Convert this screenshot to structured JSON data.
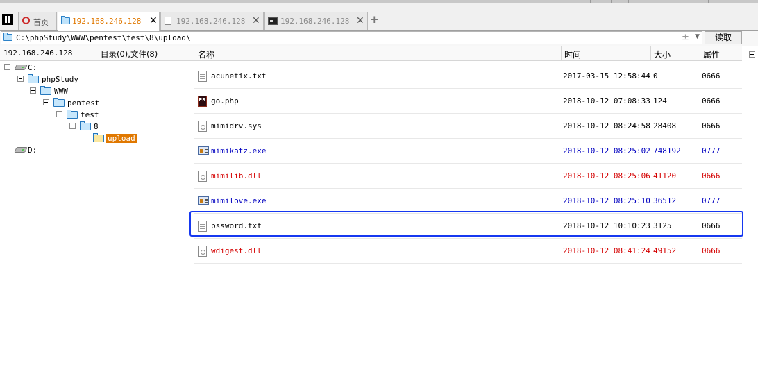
{
  "tabs": [
    {
      "label": "首页",
      "icon": "home-icon"
    },
    {
      "label": "192.168.246.128",
      "icon": "folder-icon",
      "active": true
    },
    {
      "label": "192.168.246.128",
      "icon": "file-icon"
    },
    {
      "label": "192.168.246.128",
      "icon": "terminal-icon"
    }
  ],
  "address": {
    "path": "C:\\phpStudy\\WWW\\pentest\\test\\8\\upload\\",
    "plusminus": "±",
    "read_label": "读取"
  },
  "left": {
    "host": "192.168.246.128",
    "summary": "目录(0),文件(8)"
  },
  "tree": [
    {
      "label": "C:",
      "type": "drive"
    },
    {
      "label": "phpStudy",
      "type": "folder"
    },
    {
      "label": "WWW",
      "type": "folder"
    },
    {
      "label": "pentest",
      "type": "folder"
    },
    {
      "label": "test",
      "type": "folder"
    },
    {
      "label": "8",
      "type": "folder"
    },
    {
      "label": "upload",
      "type": "folder",
      "selected": true
    },
    {
      "label": "D:",
      "type": "drive"
    }
  ],
  "columns": {
    "name": "名称",
    "time": "时间",
    "size": "大小",
    "attr": "属性"
  },
  "files": [
    {
      "name": "acunetix.txt",
      "time": "2017-03-15 12:58:44",
      "size": "0",
      "attr": "0666",
      "icon": "text-file-icon",
      "color": "#000000"
    },
    {
      "name": "go.php",
      "time": "2018-10-12 07:08:33",
      "size": "124",
      "attr": "0666",
      "icon": "php-file-icon",
      "color": "#000000"
    },
    {
      "name": "mimidrv.sys",
      "time": "2018-10-12 08:24:58",
      "size": "28408",
      "attr": "0666",
      "icon": "system-file-icon",
      "color": "#000000"
    },
    {
      "name": "mimikatz.exe",
      "time": "2018-10-12 08:25:02",
      "size": "748192",
      "attr": "0777",
      "icon": "exe-file-icon",
      "color": "#0000c0"
    },
    {
      "name": "mimilib.dll",
      "time": "2018-10-12 08:25:06",
      "size": "41120",
      "attr": "0666",
      "icon": "dll-file-icon",
      "color": "#d40000"
    },
    {
      "name": "mimilove.exe",
      "time": "2018-10-12 08:25:10",
      "size": "36512",
      "attr": "0777",
      "icon": "exe-file-icon",
      "color": "#0000c0"
    },
    {
      "name": "pssword.txt",
      "time": "2018-10-12 10:10:23",
      "size": "3125",
      "attr": "0666",
      "icon": "text-file-icon",
      "color": "#000000",
      "highlighted": true
    },
    {
      "name": "wdigest.dll",
      "time": "2018-10-12 08:41:24",
      "size": "49152",
      "attr": "0666",
      "icon": "dll-file-icon",
      "color": "#d40000"
    }
  ],
  "colors": {
    "active_tab_text": "#e07800",
    "selected_folder_bg": "#e07800",
    "highlight_border": "#1638f0",
    "exe_text": "#0000c0",
    "dll_text": "#d40000"
  }
}
